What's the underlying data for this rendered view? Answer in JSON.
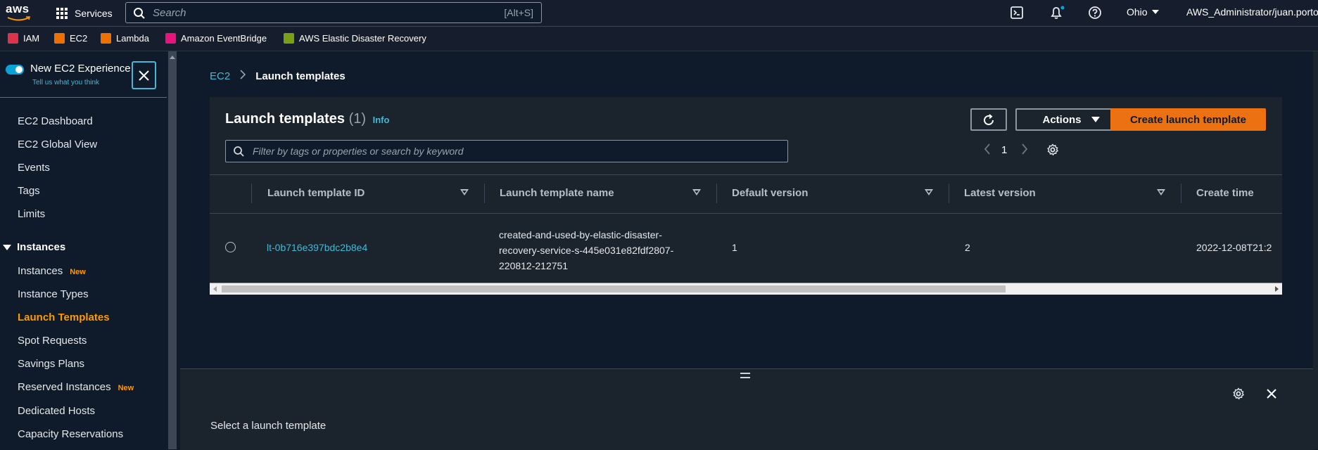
{
  "topnav": {
    "logo": "aws",
    "services_label": "Services",
    "search_placeholder": "Search",
    "search_shortcut": "[Alt+S]",
    "region": "Ohio",
    "account": "AWS_Administrator/juan.porto",
    "icons": [
      "cloudshell-icon",
      "bell-icon",
      "help-icon"
    ]
  },
  "favorites": [
    {
      "label": "IAM",
      "color": "#dd344c"
    },
    {
      "label": "EC2",
      "color": "#ed7100"
    },
    {
      "label": "Lambda",
      "color": "#ed7100"
    },
    {
      "label": "Amazon EventBridge",
      "color": "#e7157b"
    },
    {
      "label": "AWS Elastic Disaster Recovery",
      "color": "#7aa116"
    }
  ],
  "sidebar": {
    "new_experience": "New EC2 Experience",
    "tell_us": "Tell us what you think",
    "items_top": [
      "EC2 Dashboard",
      "EC2 Global View",
      "Events",
      "Tags",
      "Limits"
    ],
    "section": "Instances",
    "items_instances": [
      {
        "label": "Instances",
        "badge": "New"
      },
      {
        "label": "Instance Types",
        "badge": ""
      },
      {
        "label": "Launch Templates",
        "badge": "",
        "active": true
      },
      {
        "label": "Spot Requests",
        "badge": ""
      },
      {
        "label": "Savings Plans",
        "badge": ""
      },
      {
        "label": "Reserved Instances",
        "badge": "New"
      },
      {
        "label": "Dedicated Hosts",
        "badge": ""
      },
      {
        "label": "Capacity Reservations",
        "badge": ""
      }
    ]
  },
  "breadcrumb": {
    "root": "EC2",
    "current": "Launch templates"
  },
  "panel": {
    "title": "Launch templates",
    "count": "(1)",
    "info": "Info",
    "actions_label": "Actions",
    "create_label": "Create launch template",
    "filter_placeholder": "Filter by tags or properties or search by keyword",
    "page": "1"
  },
  "table": {
    "columns": [
      "Launch template ID",
      "Launch template name",
      "Default version",
      "Latest version",
      "Create time"
    ],
    "rows": [
      {
        "id": "lt-0b716e397bdc2b8e4",
        "name": "created-and-used-by-elastic-disaster-recovery-service-s-445e031e82fdf2807-220812-212751",
        "default_version": "1",
        "latest_version": "2",
        "create_time": "2022-12-08T21:2"
      }
    ]
  },
  "bottom": {
    "message": "Select a launch template"
  },
  "colors": {
    "accent": "#44b9d6",
    "primary_button": "#ec7211",
    "active_nav": "#ff9900"
  }
}
